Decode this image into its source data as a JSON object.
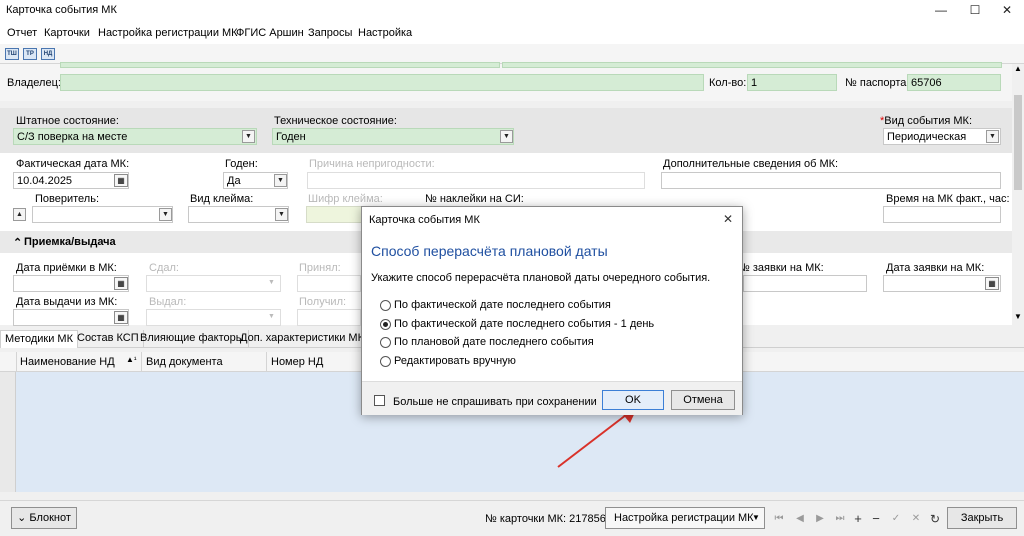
{
  "window": {
    "title": "Карточка события МК",
    "minimize": "—",
    "maximize": "☐",
    "close": "✕"
  },
  "menu": [
    "Отчет",
    "Карточки",
    "Настройка регистрации МК",
    "ФГИС Аршин",
    "Запросы",
    "Настройка"
  ],
  "toolbar_icons": [
    "ТШ",
    "ТР",
    "НД"
  ],
  "top": {
    "owner_label": "Владелец:",
    "owner_value": "",
    "qty_label": "Кол-во:",
    "qty_value": "1",
    "passport_label": "№ паспорта:",
    "passport_value": "65706"
  },
  "state": {
    "staff_label": "Штатное состояние:",
    "staff_value": "С/З поверка на месте",
    "tech_label": "Техническое состояние:",
    "tech_value": "Годен",
    "event_required_mark": "*",
    "event_label": "Вид события МК:",
    "event_value": "Периодическая"
  },
  "details": {
    "actual_date_label": "Фактическая дата МК:",
    "actual_date_value": "10.04.2025",
    "fit_label": "Годен:",
    "fit_value": "Да",
    "unfit_reason_label": "Причина непригодности:",
    "extra_info_label": "Дополнительные сведения об МК:",
    "verifier_label": "Поверитель:",
    "mark_type_label": "Вид клейма:",
    "mark_code_label": "Шифр клейма:",
    "sticker_label": "№ наклейки на СИ:",
    "time_label": "Время на МК факт., час:",
    "toggle_label": "▲"
  },
  "receive": {
    "section_title": "Приемка/выдача",
    "chevron": "⌃",
    "recv_date_label": "Дата приёмки в МК:",
    "handed_label": "Сдал:",
    "accepted_label": "Принял:",
    "request_no_label": "№ заявки на МК:",
    "request_date_label": "Дата заявки на МК:",
    "issue_date_label": "Дата выдачи из МК:",
    "issued_label": "Выдал:",
    "received_label": "Получил:"
  },
  "tabs": [
    "Методики МК",
    "Состав КСП",
    "Влияющие факторы",
    "Доп. характеристики МК"
  ],
  "grid": {
    "columns": [
      "Наименование НД",
      "Вид документа",
      "Номер НД"
    ],
    "sort_mark": "▲¹"
  },
  "statusbar": {
    "notebook_button": "Блокнот",
    "notebook_chevron": "⌄",
    "card_no_label": "№ карточки МК: 217856",
    "settings_select": "Настройка регистрации МК",
    "close_button": "Закрыть",
    "nav_icons": [
      "⏮",
      "◀",
      "▶",
      "⏭",
      "+",
      "−",
      "✓",
      "✕",
      "↻"
    ]
  },
  "dialog": {
    "title": "Карточка события МК",
    "close": "✕",
    "heading": "Способ перерасчёта плановой даты",
    "description": "Укажите способ перерасчёта плановой даты очередного события.",
    "options": [
      {
        "label": "По фактической дате последнего события",
        "selected": false
      },
      {
        "label": "По фактической дате последнего события - 1 день",
        "selected": true
      },
      {
        "label": "По плановой дате последнего события",
        "selected": false
      },
      {
        "label": "Редактировать вручную",
        "selected": false
      }
    ],
    "dont_ask_label": "Больше не спрашивать при сохранении",
    "ok_label": "OK",
    "cancel_label": "Отмена"
  },
  "colors": {
    "accent_heading": "#1f4fa0",
    "green_field": "#d5ecd5",
    "grid_body": "#dde8f5",
    "arrow": "#d9322a"
  }
}
